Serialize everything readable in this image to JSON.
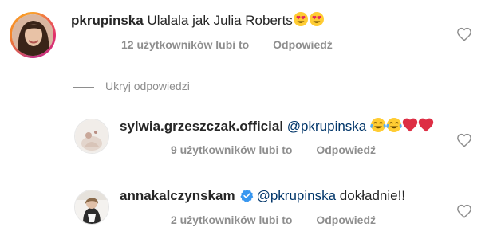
{
  "comments": [
    {
      "username": "pkrupinska",
      "text": "Ulalala jak Julia Roberts",
      "emoji": [
        "heart-eyes",
        "heart-eyes"
      ],
      "likes": "12 użytkowników lubi to",
      "reply": "Odpowiedź"
    },
    {
      "username": "sylwia.grzeszczak.official",
      "mention": "@pkrupinska",
      "emoji": [
        "tears-of-joy",
        "tears-of-joy",
        "red-heart",
        "red-heart"
      ],
      "likes": "9 użytkowników lubi to",
      "reply": "Odpowiedź"
    },
    {
      "username": "annakalczynskam",
      "verified": true,
      "mention": "@pkrupinska",
      "text": "dokładnie!!",
      "likes": "2 użytkowników lubi to",
      "reply": "Odpowiedź"
    }
  ],
  "hide_replies_label": "Ukryj odpowiedzi",
  "colors": {
    "username": "#262626",
    "mention": "#003569",
    "meta": "#8e8e8e",
    "verified": "#3897f0",
    "heart": "#ed4956"
  }
}
